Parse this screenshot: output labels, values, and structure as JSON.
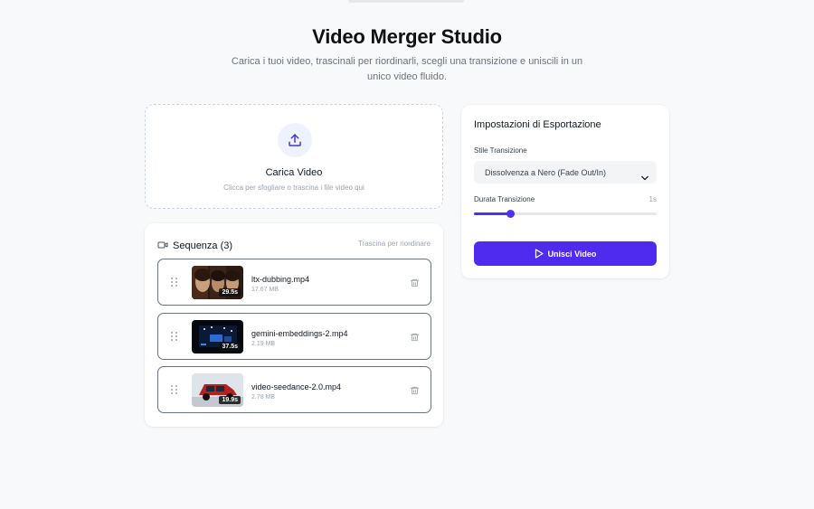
{
  "header": {
    "title": "Video Merger Studio",
    "subtitle": "Carica i tuoi video, trascinali per riordinarli, scegli una transizione e uniscili in un unico video fluido."
  },
  "upload": {
    "title": "Carica Video",
    "hint": "Clicca per sfogliare o trascina i file video qui",
    "icon": "upload-icon"
  },
  "sequence": {
    "title": "Sequenza (3)",
    "hint": "Trascina per riordinare",
    "items": [
      {
        "name": "ltx-dubbing.mp4",
        "size": "17.67 MB",
        "duration": "29.5s"
      },
      {
        "name": "gemini-embeddings-2.mp4",
        "size": "2.19 MB",
        "duration": "37.5s"
      },
      {
        "name": "video-seedance-2.0.mp4",
        "size": "2.78 MB",
        "duration": "19.9s"
      }
    ]
  },
  "settings": {
    "title": "Impostazioni di Esportazione",
    "transition_label": "Stile Transizione",
    "transition_value": "Dissolvenza a Nero (Fade Out/In)",
    "duration_label": "Durata Transizione",
    "duration_value": "1s",
    "duration_fraction": 0.2,
    "merge_label": "Unisci Video"
  },
  "colors": {
    "accent": "#4f2bf0",
    "background": "#f8f9fb"
  }
}
